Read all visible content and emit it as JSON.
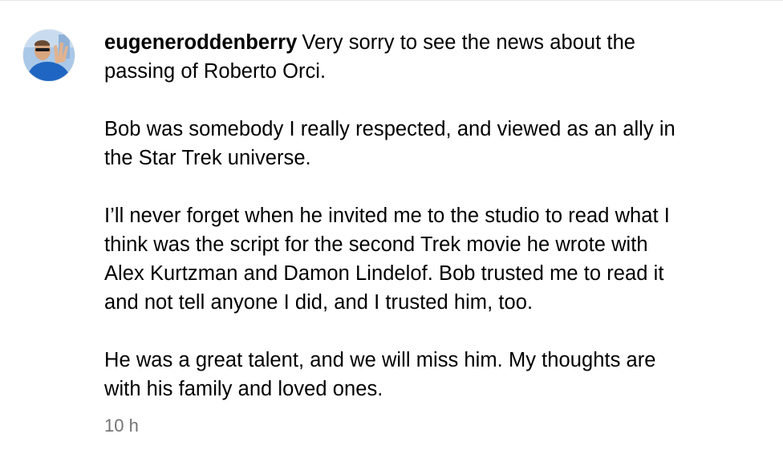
{
  "comment": {
    "username": "eugeneroddenberry",
    "paragraphs": [
      "Very sorry to see the news about the\npassing of Roberto Orci.",
      "Bob was somebody I really respected, and viewed as an ally in\nthe Star Trek universe.",
      "I’ll never forget when he invited me to the studio to read what I\nthink was the script for the second Trek movie he wrote with\nAlex Kurtzman and Damon Lindelof. Bob trusted me to read it\nand not tell anyone I did, and I trusted him, too.",
      "He was a great talent, and we will miss him. My thoughts are\nwith his family and loved ones."
    ],
    "timestamp": "10 h"
  },
  "colors": {
    "text": "#000000",
    "timestamp": "#737373",
    "avatar_bg": "#9fc2e4"
  },
  "icons": {
    "avatar": "profile-photo"
  }
}
